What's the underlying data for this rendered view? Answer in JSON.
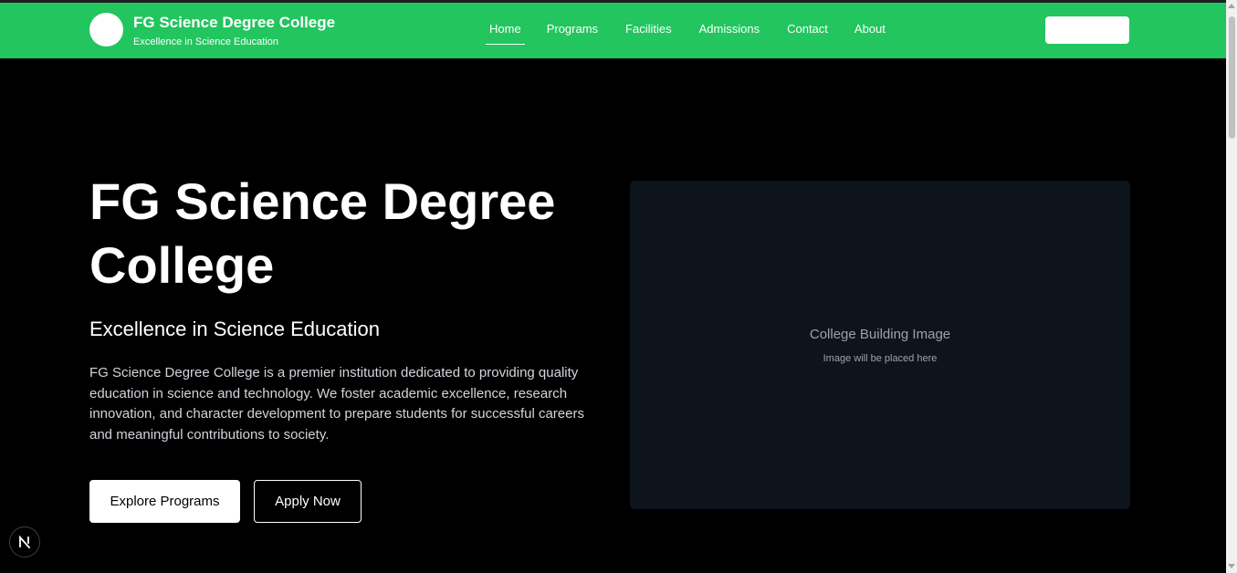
{
  "colors": {
    "navbar_bg": "#22c55e",
    "page_bg": "#000000",
    "image_box_bg": "#0e141b",
    "text_primary": "#ffffff",
    "text_muted": "#9ca3af"
  },
  "header": {
    "brand_title": "FG Science Degree College",
    "brand_subtitle": "Excellence in Science Education",
    "logo_icon": "logo-circle-icon",
    "nav": [
      {
        "label": "Home",
        "active": true
      },
      {
        "label": "Programs",
        "active": false
      },
      {
        "label": "Facilities",
        "active": false
      },
      {
        "label": "Admissions",
        "active": false
      },
      {
        "label": "Contact",
        "active": false
      },
      {
        "label": "About",
        "active": false
      }
    ]
  },
  "hero": {
    "title": "FG Science Degree College",
    "subtitle": "Excellence in Science Education",
    "description": "FG Science Degree College is a premier institution dedicated to providing quality education in science and technology. We foster academic excellence, research innovation, and character development to prepare students for successful careers and meaningful contributions to society.",
    "primary_button": "Explore Programs",
    "secondary_button": "Apply Now"
  },
  "image_placeholder": {
    "caption": "College Building Image",
    "hint": "Image will be placed here"
  },
  "dev_badge": {
    "icon": "nextjs-logo-icon",
    "letter": "N"
  }
}
